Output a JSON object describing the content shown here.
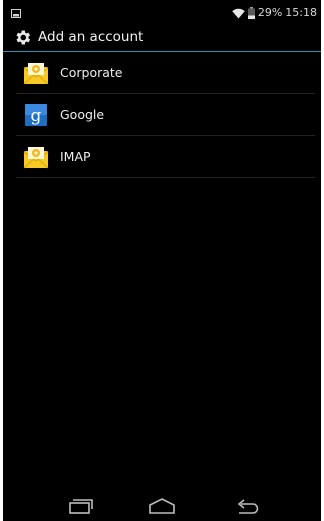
{
  "status_bar": {
    "battery_percent": "29%",
    "time": "15:18"
  },
  "action_bar": {
    "title": "Add an account",
    "icon": "gear-icon"
  },
  "accounts": [
    {
      "label": "Corporate",
      "icon": "email-envelope-icon"
    },
    {
      "label": "Google",
      "icon": "google-icon"
    },
    {
      "label": "IMAP",
      "icon": "email-envelope-icon"
    }
  ],
  "nav_bar": {
    "buttons": [
      "back-icon",
      "home-icon",
      "recent-apps-icon"
    ]
  },
  "colors": {
    "background": "#000000",
    "accent": "#2f93b4",
    "text": "#eeeeee",
    "envelope": "#f6c928",
    "google": "#1e6fc4"
  }
}
